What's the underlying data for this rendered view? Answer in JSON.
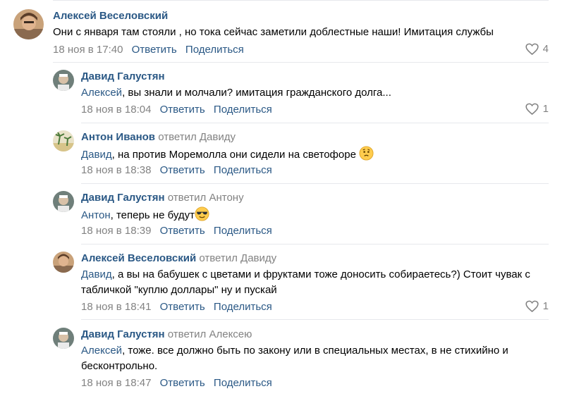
{
  "comments": [
    {
      "author": "Алексей Веселовский",
      "reply_to": "",
      "mention": "",
      "text": "Они с января там стояли , но тока сейчас заметили доблестные наши! Имитация службы",
      "date": "18 ноя в 17:40",
      "reply_label": "Ответить",
      "share_label": "Поделиться",
      "likes": "4"
    },
    {
      "author": "Давид Галустян",
      "reply_to": "",
      "mention": "Алексей",
      "text": ", вы знали и молчали? имитация гражданского долга...",
      "date": "18 ноя в 18:04",
      "reply_label": "Ответить",
      "share_label": "Поделиться",
      "likes": "1"
    },
    {
      "author": "Антон Иванов",
      "reply_to": "ответил Давиду",
      "mention": "Давид",
      "text": ", на против Моремолла они сидели на светофоре",
      "date": "18 ноя в 18:38",
      "reply_label": "Ответить",
      "share_label": "Поделиться",
      "likes": ""
    },
    {
      "author": "Давид Галустян",
      "reply_to": "ответил Антону",
      "mention": "Антон",
      "text": ", теперь не будут",
      "date": "18 ноя в 18:39",
      "reply_label": "Ответить",
      "share_label": "Поделиться",
      "likes": ""
    },
    {
      "author": "Алексей Веселовский",
      "reply_to": "ответил Давиду",
      "mention": "Давид",
      "text": ", а вы на бабушек с цветами и фруктами тоже доносить собираетесь?) Стоит чувак с табличкой \"куплю доллары\" ну и пускай",
      "date": "18 ноя в 18:41",
      "reply_label": "Ответить",
      "share_label": "Поделиться",
      "likes": "1"
    },
    {
      "author": "Давид Галустян",
      "reply_to": "ответил Алексею",
      "mention": "Алексей",
      "text": ", тоже. все должно быть по закону или в специальных местах, в не стихийно и бесконтрольно.",
      "date": "18 ноя в 18:47",
      "reply_label": "Ответить",
      "share_label": "Поделиться",
      "likes": ""
    }
  ],
  "icons": {
    "like": "heart-outline-icon",
    "thinking": "thinking-face-emoji",
    "sunglasses": "sunglasses-face-emoji"
  },
  "colors": {
    "link": "#2a5885",
    "muted": "#828282",
    "divider": "#e7e8ec"
  }
}
